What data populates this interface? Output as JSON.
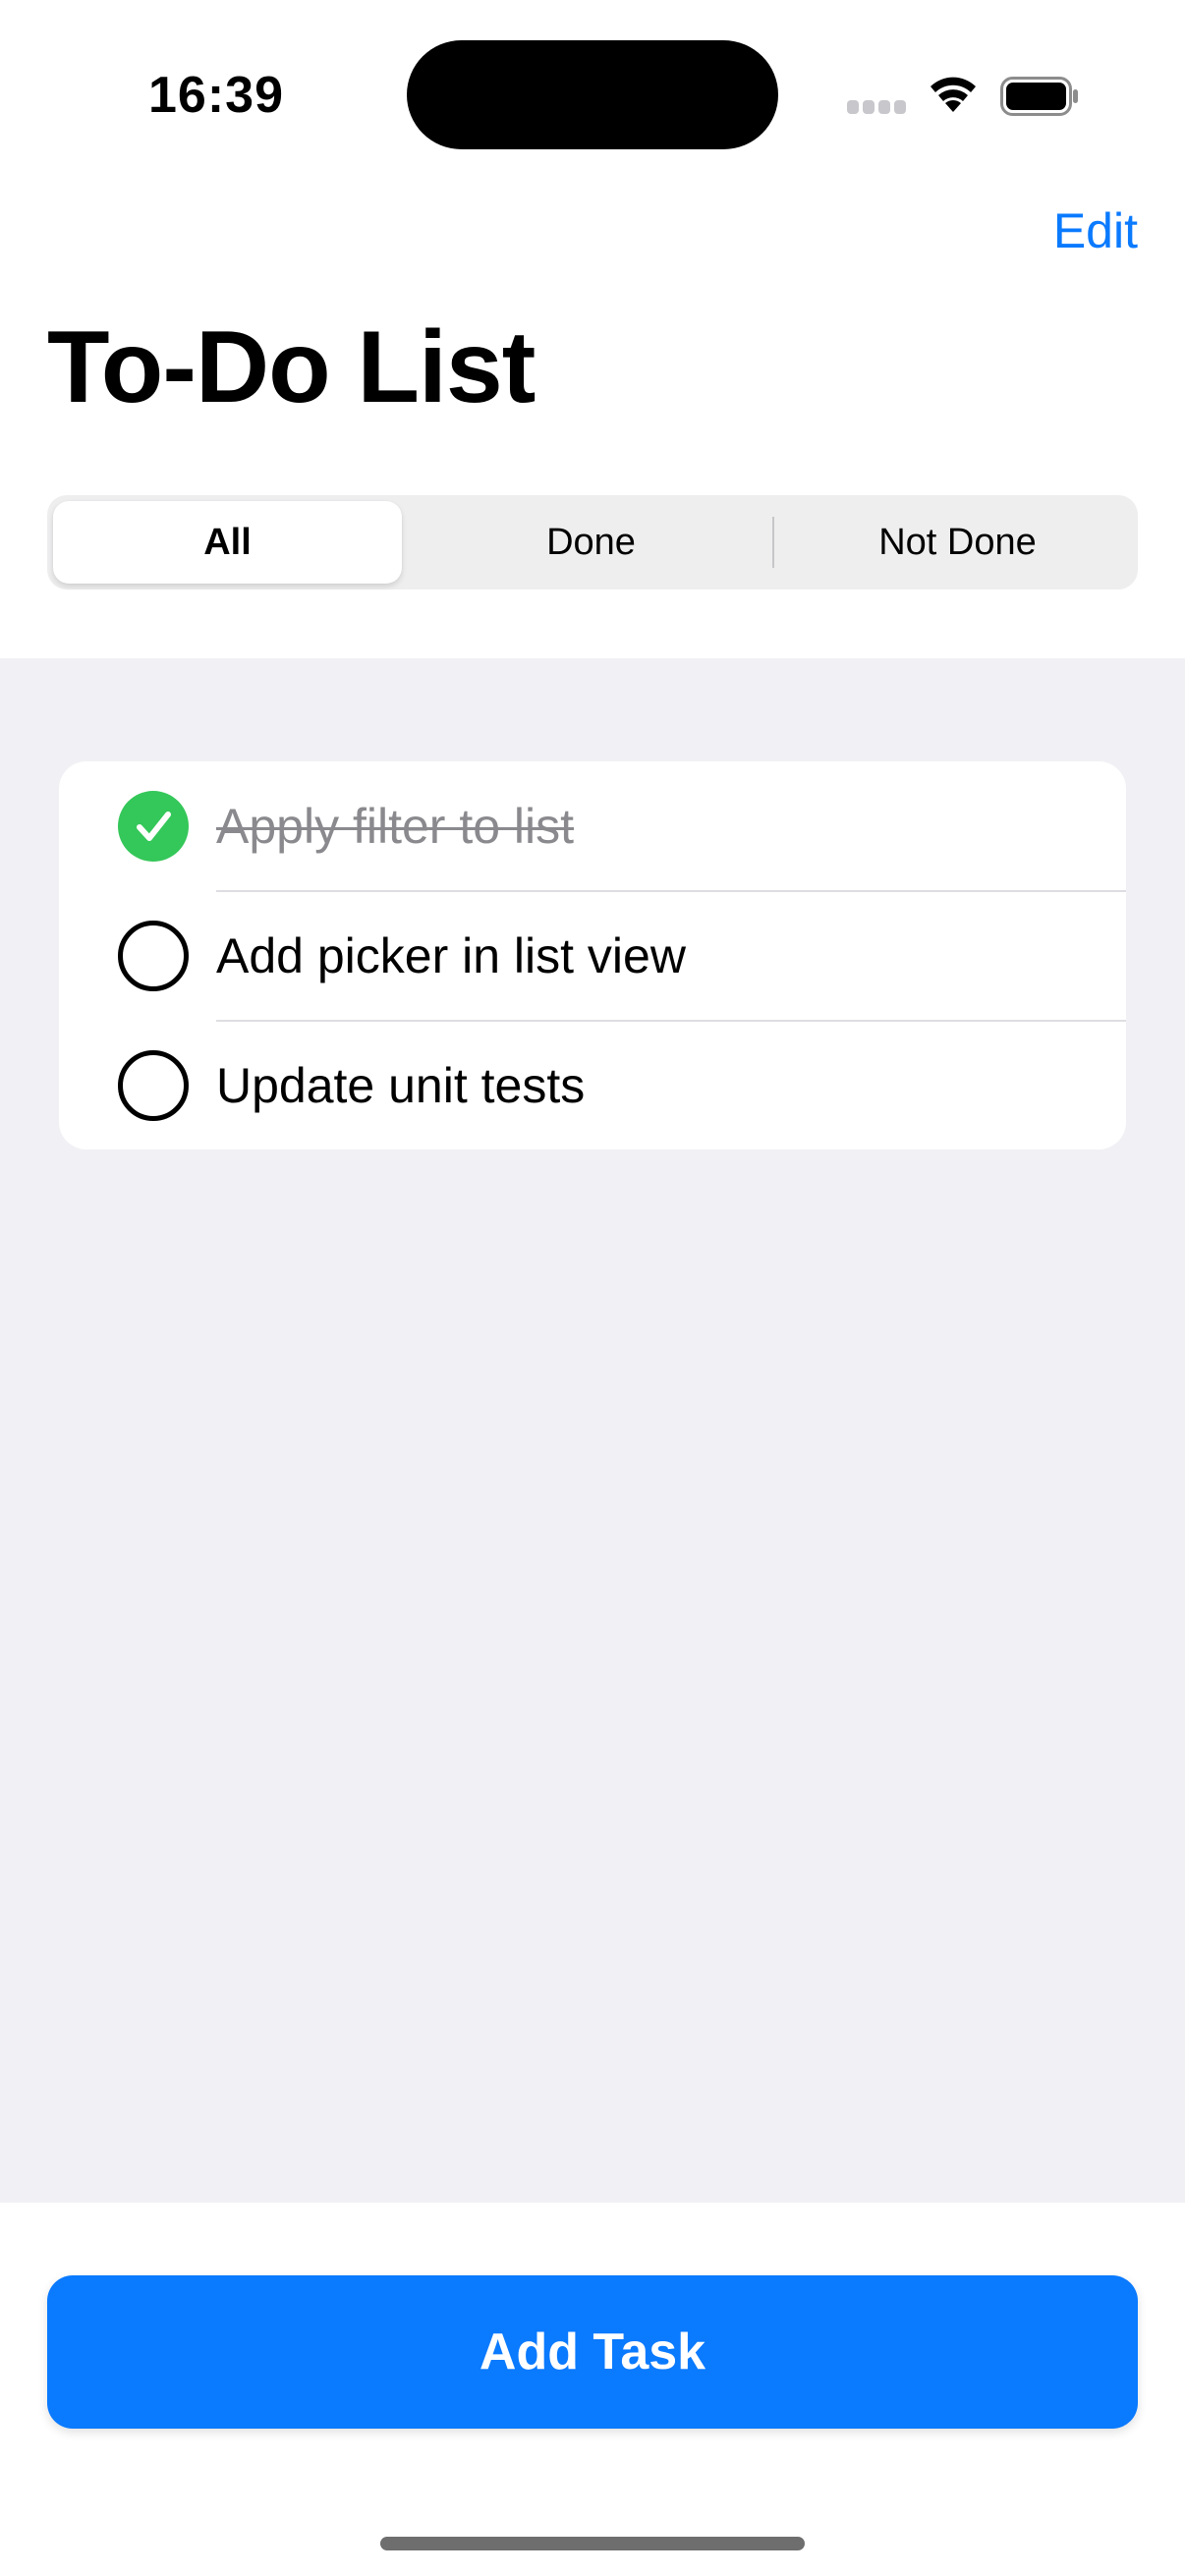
{
  "status_bar": {
    "time": "16:39",
    "icons": [
      "cellular-signal-icon",
      "wifi-icon",
      "battery-icon"
    ]
  },
  "nav": {
    "edit_label": "Edit",
    "title": "To-Do List"
  },
  "filter": {
    "segments": [
      "All",
      "Done",
      "Not Done"
    ],
    "selected": "All"
  },
  "tasks": [
    {
      "title": "Apply filter to list",
      "done": true
    },
    {
      "title": "Add picker in list view",
      "done": false
    },
    {
      "title": "Update unit tests",
      "done": false
    }
  ],
  "add_button_label": "Add Task",
  "colors": {
    "accent": "#0a7aff",
    "done_green": "#34c759",
    "list_background": "#f1f1f5"
  }
}
